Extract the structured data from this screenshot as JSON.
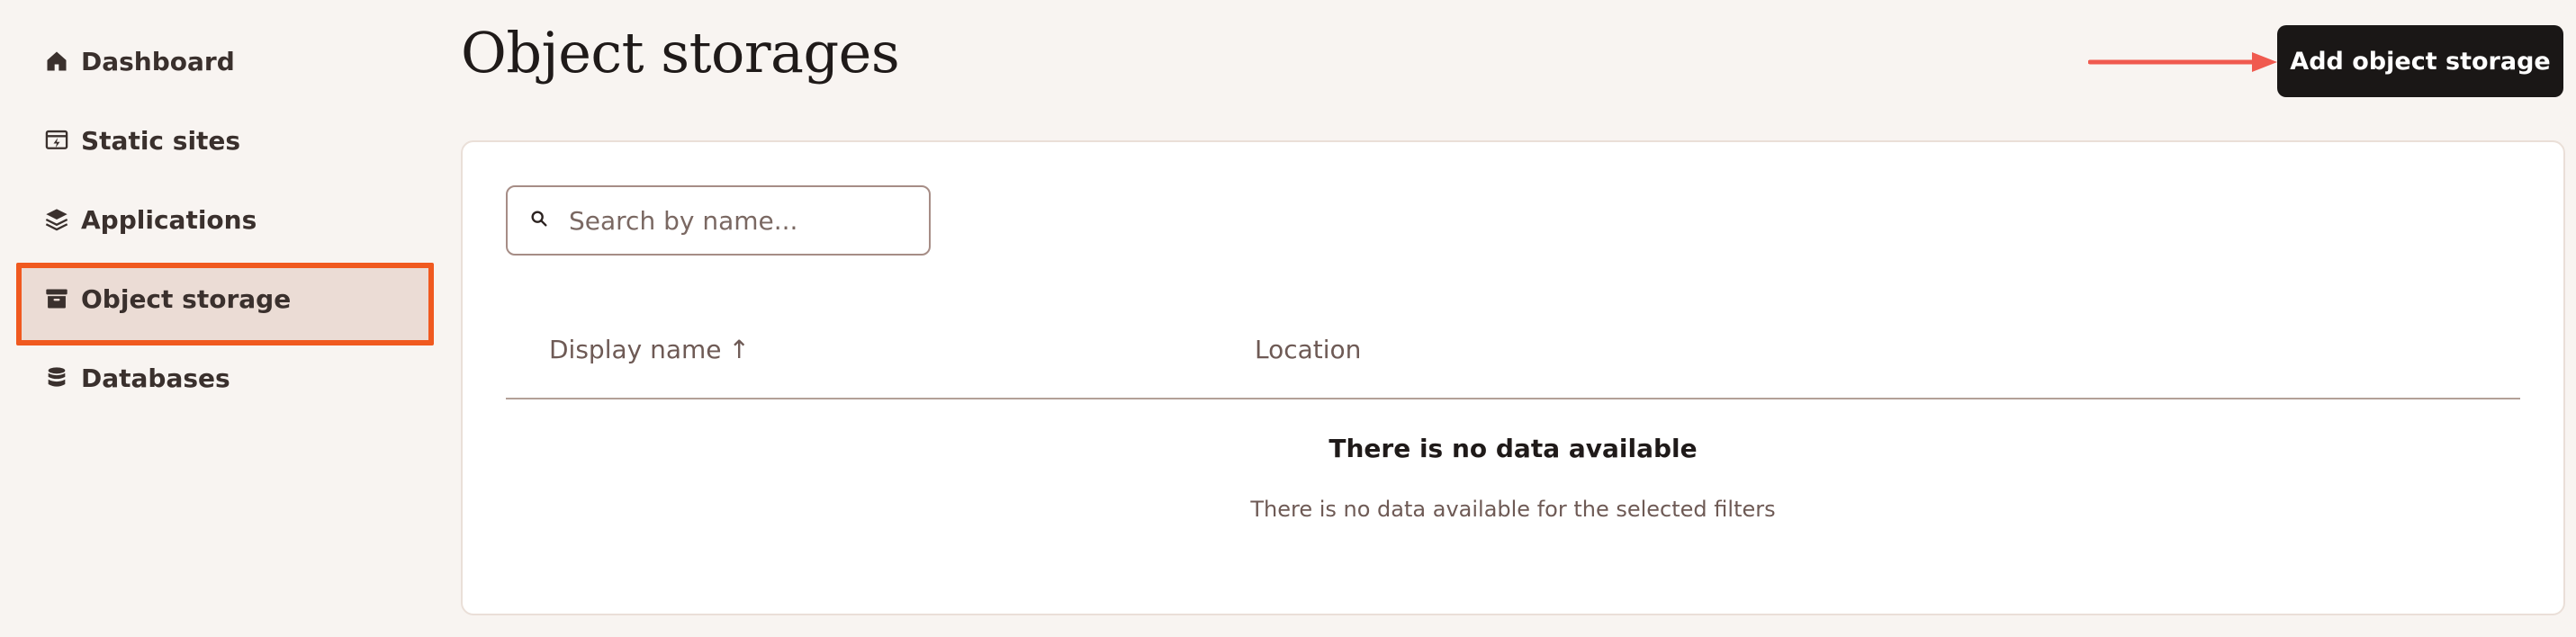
{
  "sidebar": {
    "items": [
      {
        "label": "Dashboard",
        "icon": "home-icon"
      },
      {
        "label": "Static sites",
        "icon": "static-site-icon"
      },
      {
        "label": "Applications",
        "icon": "layers-icon"
      },
      {
        "label": "Object storage",
        "icon": "archive-icon",
        "active": true
      },
      {
        "label": "Databases",
        "icon": "database-icon"
      }
    ]
  },
  "header": {
    "title": "Object storages",
    "add_button_label": "Add object storage"
  },
  "search": {
    "placeholder": "Search by name..."
  },
  "table": {
    "columns": [
      {
        "label": "Display name",
        "sort": "↑"
      },
      {
        "label": "Location"
      }
    ],
    "empty_title": "There is no data available",
    "empty_subtitle": "There is no data available for the selected filters"
  },
  "colors": {
    "background": "#f8f4f1",
    "active_highlight": "#f0591f",
    "annotation_arrow": "#f05a4f",
    "primary_button": "#1a1716"
  }
}
